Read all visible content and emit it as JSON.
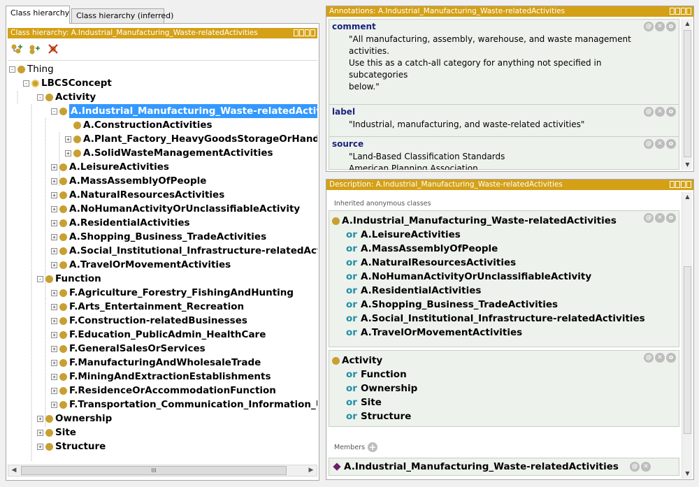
{
  "left_pane": {
    "tabs": [
      "Class hierarchy",
      "Class hierarchy (inferred)"
    ],
    "header": "Class hierarchy: A.Industrial_Manufacturing_Waste-relatedActivities",
    "tree": [
      {
        "label": "Thing",
        "expander": "-"
      },
      {
        "label": "LBCSConcept",
        "expander": "-"
      },
      {
        "label": "Activity",
        "expander": "-"
      },
      {
        "label": "A.Industrial_Manufacturing_Waste-relatedActivities",
        "expander": "-"
      },
      {
        "label": "A.ConstructionActivities",
        "expander": ""
      },
      {
        "label": "A.Plant_Factory_HeavyGoodsStorageOrHandling",
        "expander": "+"
      },
      {
        "label": "A.SolidWasteManagementActivities",
        "expander": "+"
      },
      {
        "label": "A.LeisureActivities",
        "expander": "+"
      },
      {
        "label": "A.MassAssemblyOfPeople",
        "expander": "+"
      },
      {
        "label": "A.NaturalResourcesActivities",
        "expander": "+"
      },
      {
        "label": "A.NoHumanActivityOrUnclassifiableActivity",
        "expander": "+"
      },
      {
        "label": "A.ResidentialActivities",
        "expander": "+"
      },
      {
        "label": "A.Shopping_Business_TradeActivities",
        "expander": "+"
      },
      {
        "label": "A.Social_Institutional_Infrastructure-relatedActivities",
        "expander": "+"
      },
      {
        "label": "A.TravelOrMovementActivities",
        "expander": "+"
      },
      {
        "label": "Function",
        "expander": "-"
      },
      {
        "label": "F.Agriculture_Forestry_FishingAndHunting",
        "expander": "+"
      },
      {
        "label": "F.Arts_Entertainment_Recreation",
        "expander": "+"
      },
      {
        "label": "F.Construction-relatedBusinesses",
        "expander": "+"
      },
      {
        "label": "F.Education_PublicAdmin_HealthCare",
        "expander": "+"
      },
      {
        "label": "F.GeneralSalesOrServices",
        "expander": "+"
      },
      {
        "label": "F.ManufacturingAndWholesaleTrade",
        "expander": "+"
      },
      {
        "label": "F.MiningAndExtractionEstablishments",
        "expander": "+"
      },
      {
        "label": "F.ResidenceOrAccommodationFunction",
        "expander": "+"
      },
      {
        "label": "F.Transportation_Communication_Information_Utilities",
        "expander": "+"
      },
      {
        "label": "Ownership",
        "expander": "+"
      },
      {
        "label": "Site",
        "expander": "+"
      },
      {
        "label": "Structure",
        "expander": "+"
      }
    ],
    "scroll_thumb": "III"
  },
  "annotations": {
    "header": "Annotations: A.Industrial_Manufacturing_Waste-relatedActivities",
    "items": [
      {
        "property": "comment",
        "value": "\"All manufacturing, assembly, warehouse, and waste management\nactivities.\nUse this as a catch-all category for anything not specified in\nsubcategories\nbelow.\""
      },
      {
        "property": "label",
        "value": "\"Industrial, manufacturing, and waste-related activities\""
      },
      {
        "property": "source",
        "value": "\"Land-Based Classification Standards\nAmerican Planning Association"
      }
    ]
  },
  "description": {
    "header": "Description: A.Industrial_Manufacturing_Waste-relatedActivities",
    "inherited_label": "Inherited anonymous classes",
    "or_keyword": "or",
    "block1_head": "A.Industrial_Manufacturing_Waste-relatedActivities",
    "block1_ors": [
      "A.LeisureActivities",
      "A.MassAssemblyOfPeople",
      "A.NaturalResourcesActivities",
      "A.NoHumanActivityOrUnclassifiableActivity",
      "A.ResidentialActivities",
      "A.Shopping_Business_TradeActivities",
      "A.Social_Institutional_Infrastructure-relatedActivities",
      "A.TravelOrMovementActivities"
    ],
    "block2_head": "Activity",
    "block2_ors": [
      "Function",
      "Ownership",
      "Site",
      "Structure"
    ],
    "members_label": "Members",
    "member": "A.Industrial_Manufacturing_Waste-relatedActivities"
  },
  "controls": {
    "annotate": "@",
    "delete": "✕",
    "edit": "o"
  },
  "colors": {
    "header": "#d4a016",
    "class_dot": "#c8a032",
    "selection": "#3399ff",
    "or_keyword": "#1e8ea6",
    "property": "#1a237e",
    "individual": "#6a1f6a"
  }
}
